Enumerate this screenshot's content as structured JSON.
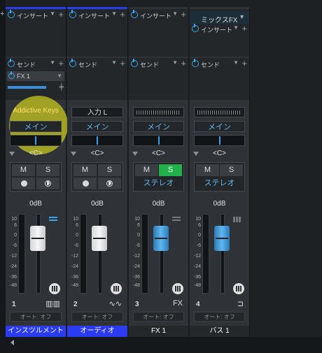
{
  "colors": {
    "accent": "#3aa3e8",
    "instrument_label_bg": "#2b3bf0",
    "solo_active": "#22b04a",
    "highlight": "#cdcd1e"
  },
  "labels": {
    "insert": "インサート",
    "send": "センド",
    "output_main": "メイン",
    "pan": "<C>",
    "mute": "M",
    "solo": "S",
    "stereo": "ステレオ",
    "level": "0dB",
    "automation": "オート: オフ",
    "fx1_send": "FX 1",
    "mix_fx": "ミックスFX"
  },
  "scale": [
    "10",
    "6",
    "0",
    "-6",
    "-12",
    "-24",
    "-36",
    "-48"
  ],
  "channels": [
    {
      "number": "1",
      "source": "Addictive Keys",
      "name": "インスツルメント",
      "type_icon": "keyboard-icon"
    },
    {
      "number": "2",
      "source": "入力 L",
      "name": "オーディオ",
      "type_icon": "waveform-icon"
    },
    {
      "number": "3",
      "source": "",
      "name": "FX 1",
      "type_icon": "FX"
    },
    {
      "number": "4",
      "source": "",
      "name": "バス 1",
      "type_icon": "bus-icon"
    }
  ]
}
